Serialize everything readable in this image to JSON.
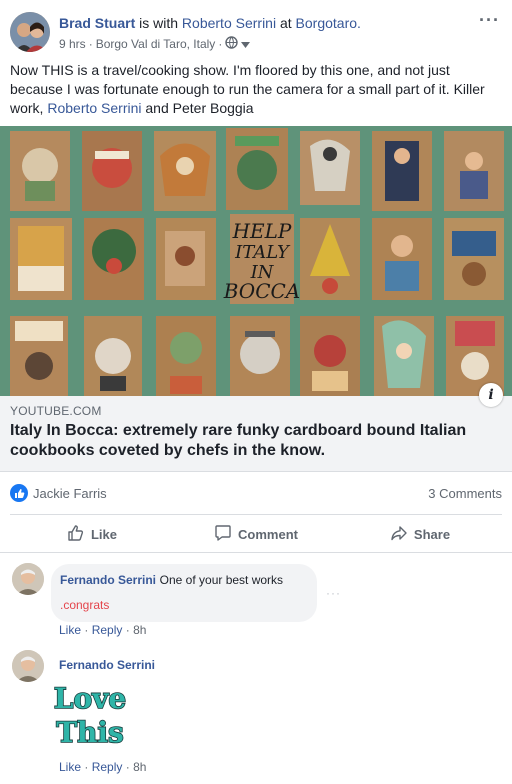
{
  "post": {
    "author": "Brad Stuart",
    "with_text": " is with ",
    "tagged": "Roberto Serrini",
    "at_text": " at ",
    "place": "Borgotaro.",
    "time": "9 hrs",
    "sep": "·",
    "location": "Borgo Val di Taro, Italy",
    "privacy_icon": "globe-icon",
    "text_part1": "Now THIS is a travel/cooking show. I'm floored by this one, and not just because I was fortunate enough to run the camera for a small part of it. Killer work, ",
    "text_link": "Roberto Serrini",
    "text_part2": " and Peter Boggia"
  },
  "media": {
    "center_text_line1": "HELP",
    "center_text_line2": "ITALY",
    "center_text_line3": "IN",
    "center_text_line4": "BOCCA"
  },
  "link_preview": {
    "domain": "YOUTUBE.COM",
    "title": "Italy In Bocca: extremely rare funky cardboard bound Italian cookbooks coveted by chefs in the know."
  },
  "reactions": {
    "name": "Jackie Farris",
    "comments": "3 Comments"
  },
  "actions": {
    "like": "Like",
    "comment": "Comment",
    "share": "Share"
  },
  "comments": [
    {
      "author": "Fernando Serrini",
      "text": "One of your best works",
      "text2": ".congrats",
      "like": "Like",
      "reply": "Reply",
      "time": "8h",
      "sep": "·"
    },
    {
      "author": "Fernando Serrini",
      "sticker_line1": "Love",
      "sticker_line2": "This",
      "like": "Like",
      "reply": "Reply",
      "time": "8h",
      "sep": "·"
    }
  ],
  "colors": {
    "link": "#385898",
    "like_blue": "#1877f2",
    "congrats_red": "#e4454c",
    "sticker_teal": "#2fb5a8"
  }
}
